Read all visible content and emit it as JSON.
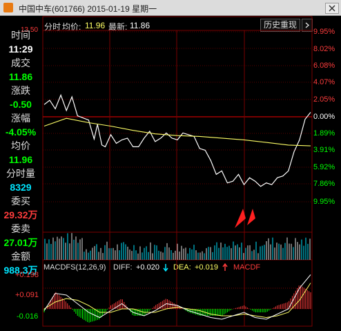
{
  "window": {
    "title": "中国中车(601766) 2015-01-19 星期一",
    "close_icon": "close-icon",
    "app_icon": "app-icon"
  },
  "header": {
    "label_time": "分时",
    "label_avg": "均价:",
    "avg_value": "11.96",
    "label_latest": "最新:",
    "latest_value": "11.86",
    "history_button": "历史重现",
    "scroll_icon": "chevron-right-icon"
  },
  "sidebar": {
    "top_price": "13.50",
    "items": [
      {
        "label": "时间",
        "value": "11:29",
        "value_color": "#ffffff"
      },
      {
        "label": "成交",
        "value": "11.86",
        "value_color": "#00ff00"
      },
      {
        "label": "涨跌",
        "value": "-0.50",
        "value_color": "#00ff00"
      },
      {
        "label": "涨幅",
        "value": "-4.05%",
        "value_color": "#00ff00"
      },
      {
        "label": "均价",
        "value": "11.96",
        "value_color": "#00ff00"
      },
      {
        "label": "分时量",
        "value": "8329",
        "value_color": "#00e5ff"
      },
      {
        "label": "委买",
        "value": "29.32万",
        "value_color": "#ff3c3c"
      },
      {
        "label": "委卖",
        "value": "27.01万",
        "value_color": "#00ff00"
      },
      {
        "label": "金额",
        "value": "988.3万",
        "value_color": "#00e5ff"
      }
    ]
  },
  "pct_axis": [
    "9.95%",
    "8.02%",
    "6.08%",
    "4.07%",
    "2.05%",
    "0.00%",
    "1.89%",
    "3.91%",
    "5.92%",
    "7.86%",
    "9.95%"
  ],
  "pct_axis_colors": [
    "#ff3c3c",
    "#ff3c3c",
    "#ff3c3c",
    "#ff3c3c",
    "#ff3c3c",
    "#ffffff",
    "#00ff00",
    "#00ff00",
    "#00ff00",
    "#00ff00",
    "#00ff00"
  ],
  "macd": {
    "label": "MACDFS(12,26,9)",
    "diff_label": "DIFF:",
    "diff_value": "+0.020",
    "dea_label": "DEA:",
    "dea_value": "+0.019",
    "macd_label": "MACDF",
    "axis": [
      "+0.198",
      "+0.091",
      "-0.016"
    ]
  },
  "colors": {
    "up": "#ff3c3c",
    "down": "#00ff00",
    "grid": "#7a0000",
    "price_line": "#ffffff",
    "avg_line": "#ffff66",
    "volume": "#00e5ff",
    "arrows": "#ff2020"
  },
  "chart_data": {
    "type": "line",
    "title": "中国中车(601766) 2015-01-19 星期一",
    "ylim_pct": [
      -9.95,
      9.95
    ],
    "prev_close": 12.36,
    "series": [
      {
        "name": "分时",
        "x": [
          0,
          5,
          10,
          15,
          20,
          25,
          30,
          40,
          45,
          48,
          52,
          55,
          60,
          65,
          70,
          75,
          80,
          85,
          90,
          95,
          100,
          105,
          110,
          115,
          120,
          125,
          130,
          135,
          140,
          145,
          150,
          155,
          160,
          165,
          170,
          175,
          180,
          185,
          190,
          195,
          200,
          205,
          210,
          215,
          220,
          225,
          230,
          235,
          240
        ],
        "values": [
          1.5,
          2.0,
          1.0,
          2.6,
          0.8,
          2.4,
          0.2,
          -0.3,
          -2.5,
          -0.8,
          -3.2,
          -3.4,
          -2.0,
          -3.0,
          -2.6,
          -2.4,
          -3.4,
          -3.4,
          -2.4,
          -1.6,
          -2.8,
          -2.4,
          -1.8,
          -2.4,
          -2.6,
          -1.8,
          -2.0,
          -2.2,
          -3.6,
          -3.8,
          -5.0,
          -6.6,
          -6.2,
          -7.6,
          -7.4,
          -6.6,
          -7.8,
          -7.0,
          -7.4,
          -8.0,
          -7.6,
          -7.8,
          -7.0,
          -6.8,
          -6.2,
          -4.0,
          -2.6,
          -0.2,
          0.6
        ]
      },
      {
        "name": "均价",
        "x": [
          0,
          20,
          40,
          60,
          80,
          100,
          120,
          140,
          160,
          180,
          200,
          220,
          240
        ],
        "values": [
          -1.0,
          -0.1,
          -0.6,
          -1.0,
          -1.5,
          -1.9,
          -2.1,
          -2.2,
          -2.4,
          -2.6,
          -2.9,
          -3.2,
          -3.3
        ]
      }
    ],
    "macd": {
      "x": [
        0,
        10,
        20,
        30,
        40,
        50,
        60,
        70,
        80,
        90,
        100,
        110,
        120,
        130,
        140,
        150,
        160,
        170,
        180,
        190,
        200,
        210,
        220,
        230,
        240
      ],
      "diff": [
        -0.01,
        0.09,
        0.08,
        0.03,
        -0.02,
        -0.05,
        -0.01,
        0.03,
        -0.02,
        -0.04,
        -0.01,
        0.03,
        0.02,
        -0.01,
        -0.03,
        -0.05,
        -0.06,
        -0.04,
        -0.02,
        -0.05,
        -0.06,
        -0.03,
        0.0,
        0.12,
        0.198
      ],
      "dea": [
        0.0,
        0.04,
        0.06,
        0.05,
        0.02,
        -0.02,
        -0.02,
        0.0,
        0.0,
        -0.02,
        -0.02,
        0.0,
        0.01,
        0.0,
        -0.01,
        -0.03,
        -0.04,
        -0.04,
        -0.03,
        -0.04,
        -0.05,
        -0.04,
        -0.02,
        0.05,
        0.15
      ],
      "ylim": [
        -0.06,
        0.2
      ]
    }
  }
}
